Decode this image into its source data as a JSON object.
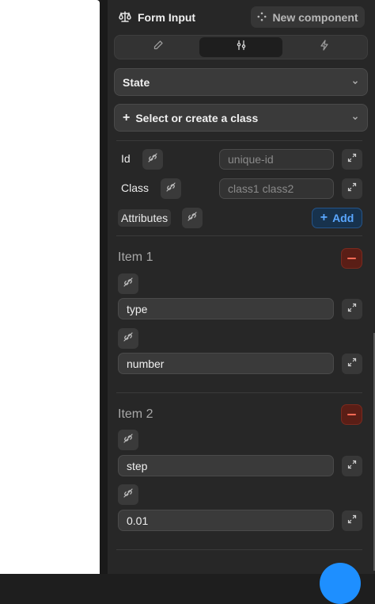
{
  "header": {
    "title": "Form Input",
    "title_icon": "scale-icon",
    "new_component_label": "New component",
    "new_component_icon": "sparkle-icon"
  },
  "tabs": [
    {
      "icon": "pencil-icon",
      "active": false
    },
    {
      "icon": "sliders-icon",
      "active": true
    },
    {
      "icon": "lightning-icon",
      "active": false
    }
  ],
  "state_select": {
    "value": "State"
  },
  "class_select": {
    "value": "Select or create a class",
    "prefix": "+"
  },
  "fields": {
    "id": {
      "label": "Id",
      "placeholder": "unique-id"
    },
    "class": {
      "label": "Class",
      "placeholder": "class1 class2"
    },
    "attributes": {
      "label": "Attributes",
      "add_label": "Add",
      "add_prefix": "+"
    }
  },
  "items": [
    {
      "title": "Item 1",
      "key": "type",
      "value": "number"
    },
    {
      "title": "Item 2",
      "key": "step",
      "value": "0.01"
    }
  ],
  "colors": {
    "accent_blue": "#1e8fff",
    "danger_red": "#ff6a55",
    "panel_bg": "#272727"
  }
}
